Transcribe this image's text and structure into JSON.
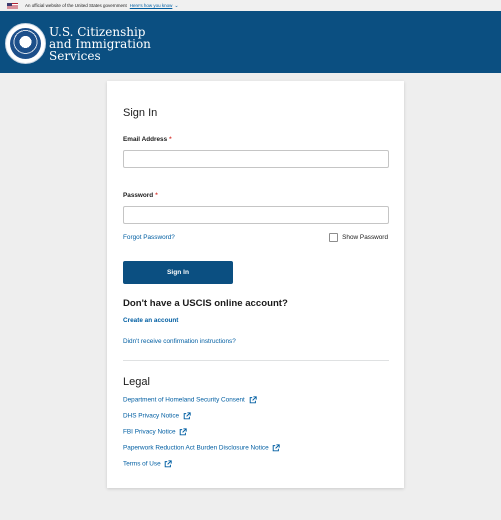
{
  "gov_banner": {
    "text": "An official website of the United States government",
    "link": "Here's how you know"
  },
  "header": {
    "line1": "U.S. Citizenship",
    "line2": "and Immigration",
    "line3": "Services"
  },
  "signin": {
    "title": "Sign In",
    "email_label": "Email Address",
    "password_label": "Password",
    "required_mark": "*",
    "email_value": "",
    "password_value": "",
    "forgot_password": "Forgot Password?",
    "show_password": "Show Password",
    "submit_label": "Sign In"
  },
  "account": {
    "heading": "Don't have a USCIS online account?",
    "create": "Create an account",
    "confirmation": "Didn't receive confirmation instructions?"
  },
  "legal": {
    "title": "Legal",
    "links": [
      "Department of Homeland Security Consent",
      "DHS Privacy Notice",
      "FBI Privacy Notice",
      "Paperwork Reduction Act Burden Disclosure Notice",
      "Terms of Use"
    ]
  },
  "colors": {
    "header_bg": "#0b4f81",
    "button_bg": "#0b4f81",
    "link": "#005ea2",
    "required": "#d83933",
    "page_bg": "#eeeeee"
  },
  "icons": {
    "flag": "us-flag-icon",
    "seal": "dhs-seal-icon",
    "external_link": "external-link-icon",
    "chevron": "chevron-down-icon"
  }
}
